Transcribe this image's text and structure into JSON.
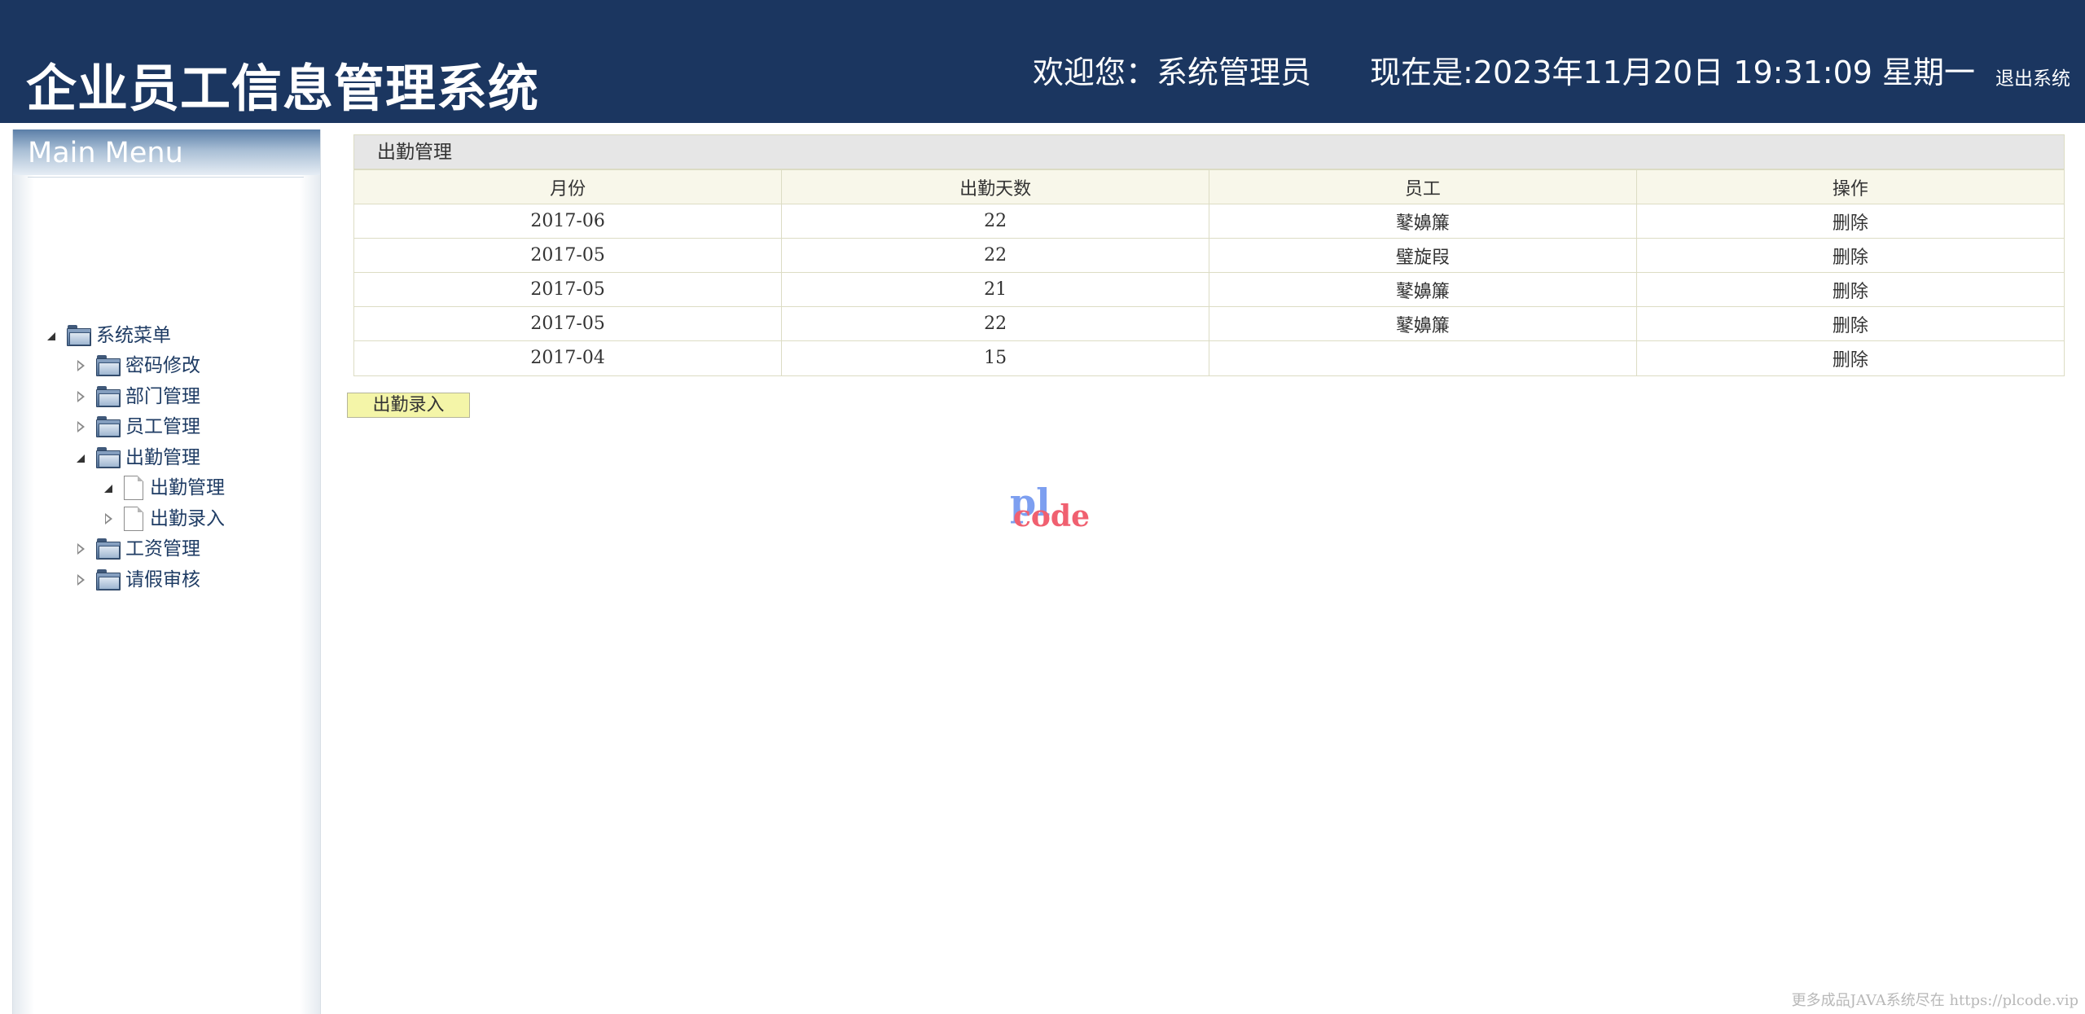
{
  "header": {
    "app_title": "企业员工信息管理系统",
    "welcome": "欢迎您：系统管理员",
    "clock": "现在是:2023年11月20日 19:31:09 星期一",
    "logout_label": "退出系统"
  },
  "sidebar": {
    "title": "Main Menu",
    "root_label": "系统菜单",
    "items": [
      {
        "label": "密码修改"
      },
      {
        "label": "部门管理"
      },
      {
        "label": "员工管理"
      },
      {
        "label": "出勤管理"
      },
      {
        "label": "出勤管理"
      },
      {
        "label": "出勤录入"
      },
      {
        "label": "工资管理"
      },
      {
        "label": "请假审核"
      }
    ]
  },
  "main": {
    "panel_title": "出勤管理",
    "columns": [
      "月份",
      "出勤天数",
      "员工",
      "操作"
    ],
    "rows": [
      {
        "month": "2017-06",
        "days": "22",
        "employee": "鼕嬶簾",
        "action": "删除"
      },
      {
        "month": "2017-05",
        "days": "22",
        "employee": "璧旋叚",
        "action": "删除"
      },
      {
        "month": "2017-05",
        "days": "21",
        "employee": "鼕嬶簾",
        "action": "删除"
      },
      {
        "month": "2017-05",
        "days": "22",
        "employee": "鼕嬶簾",
        "action": "删除"
      },
      {
        "month": "2017-04",
        "days": "15",
        "employee": "",
        "action": "删除"
      }
    ],
    "add_button_label": "出勤录入"
  },
  "watermark": {
    "logo_top": "pl",
    "logo_bottom": "code",
    "footer_note": "更多成品JAVA系统尽在 https://plcode.vip"
  },
  "colors": {
    "header_bg": "#1b3660",
    "table_header_bg": "#f8f7ea",
    "add_button_bg": "#f4f5a8"
  }
}
